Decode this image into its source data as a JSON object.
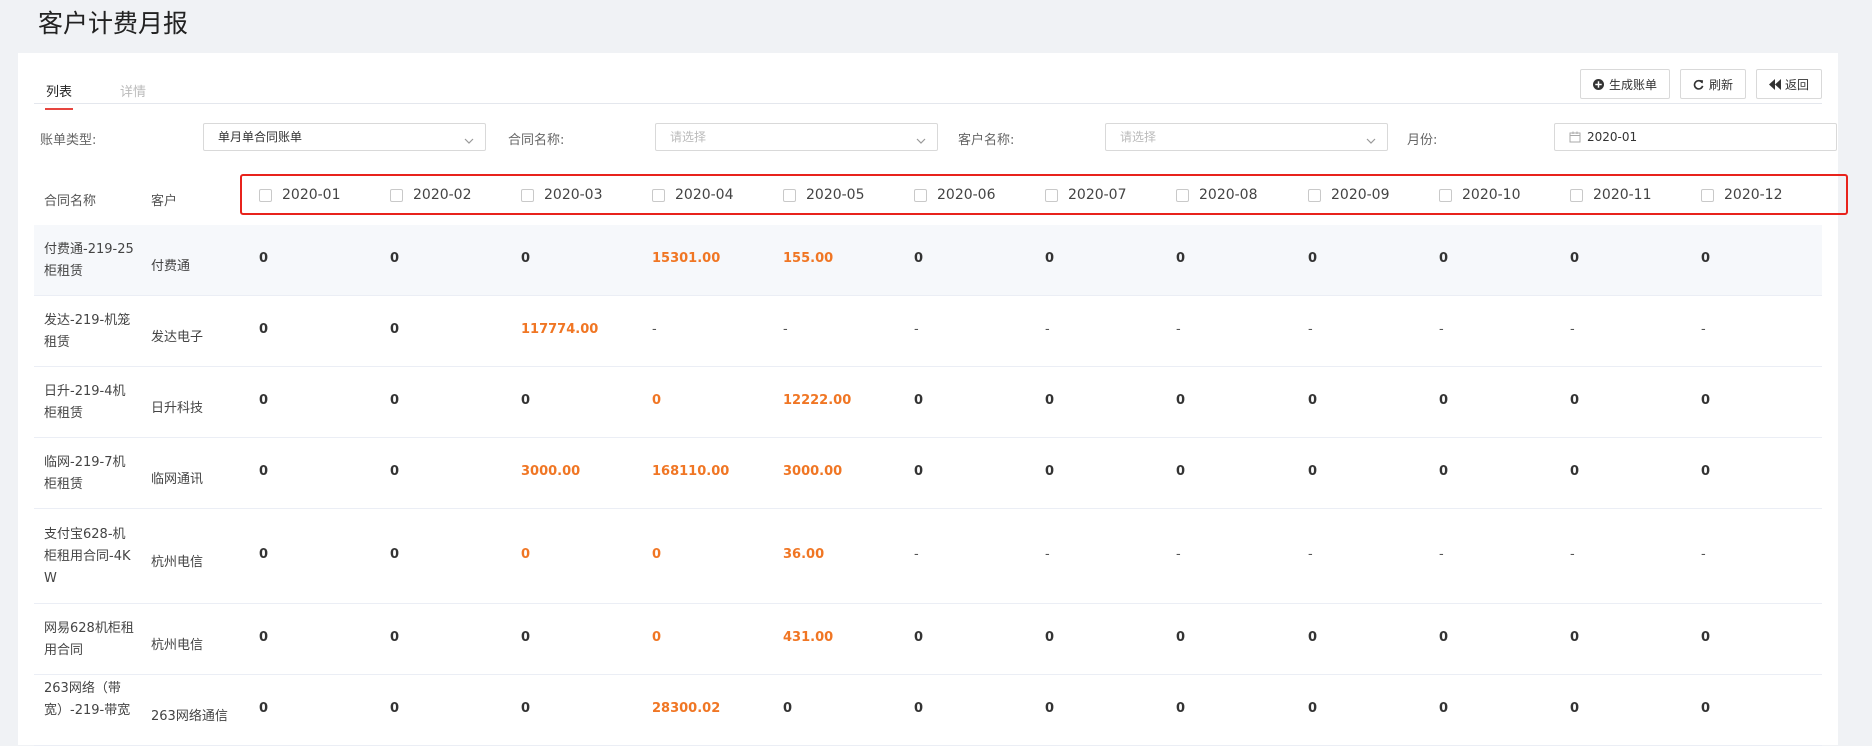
{
  "page": {
    "title": "客户计费月报"
  },
  "tabs": [
    {
      "label": "列表",
      "active": true
    },
    {
      "label": "详情",
      "active": false
    }
  ],
  "toolbar": {
    "generate_label": "生成账单",
    "refresh_label": "刷新",
    "back_label": "返回"
  },
  "filters": {
    "bill_type": {
      "label": "账单类型:",
      "value": "单月单合同账单"
    },
    "contract": {
      "label": "合同名称:",
      "placeholder": "请选择"
    },
    "customer": {
      "label": "客户名称:",
      "placeholder": "请选择"
    },
    "month": {
      "label": "月份:",
      "value": "2020-01"
    }
  },
  "table": {
    "columns": {
      "contract": "合同名称",
      "customer": "客户",
      "months": [
        "2020-01",
        "2020-02",
        "2020-03",
        "2020-04",
        "2020-05",
        "2020-06",
        "2020-07",
        "2020-08",
        "2020-09",
        "2020-10",
        "2020-11",
        "2020-12"
      ]
    },
    "rows": [
      {
        "contract": "付费通-219-25柜租赁",
        "customer": "付费通",
        "highlighted_months": [
          4,
          5
        ],
        "values": [
          "0",
          "0",
          "0",
          "15301.00",
          "155.00",
          "0",
          "0",
          "0",
          "0",
          "0",
          "0",
          "0"
        ]
      },
      {
        "contract": "发达-219-机笼租赁",
        "customer": "发达电子",
        "highlighted_months": [
          3
        ],
        "values": [
          "0",
          "0",
          "117774.00",
          "-",
          "-",
          "-",
          "-",
          "-",
          "-",
          "-",
          "-",
          "-"
        ]
      },
      {
        "contract": "日升-219-4机柜租赁",
        "customer": "日升科技",
        "highlighted_months": [
          4,
          5
        ],
        "values": [
          "0",
          "0",
          "0",
          "0",
          "12222.00",
          "0",
          "0",
          "0",
          "0",
          "0",
          "0",
          "0"
        ]
      },
      {
        "contract": "临网-219-7机柜租赁",
        "customer": "临网通讯",
        "highlighted_months": [
          3,
          4,
          5
        ],
        "values": [
          "0",
          "0",
          "3000.00",
          "168110.00",
          "3000.00",
          "0",
          "0",
          "0",
          "0",
          "0",
          "0",
          "0"
        ]
      },
      {
        "contract": "支付宝628-机柜租用合同-4KW",
        "customer": "杭州电信",
        "highlighted_months": [
          3,
          4,
          5
        ],
        "values": [
          "0",
          "0",
          "0",
          "0",
          "36.00",
          "-",
          "-",
          "-",
          "-",
          "-",
          "-",
          "-"
        ]
      },
      {
        "contract": "网易628机柜租用合同",
        "customer": "杭州电信",
        "highlighted_months": [
          4,
          5
        ],
        "values": [
          "0",
          "0",
          "0",
          "0",
          "431.00",
          "0",
          "0",
          "0",
          "0",
          "0",
          "0",
          "0"
        ]
      },
      {
        "contract": "263网络（带宽）-219-带宽",
        "customer": "263网络通信",
        "highlighted_months": [
          4
        ],
        "values": [
          "0",
          "0",
          "0",
          "28300.02",
          "0",
          "0",
          "0",
          "0",
          "0",
          "0",
          "0",
          "0"
        ]
      }
    ]
  },
  "colors": {
    "accent_red": "#e6453f",
    "highlight_box": "#e8231c",
    "value_orange": "#f07624"
  }
}
